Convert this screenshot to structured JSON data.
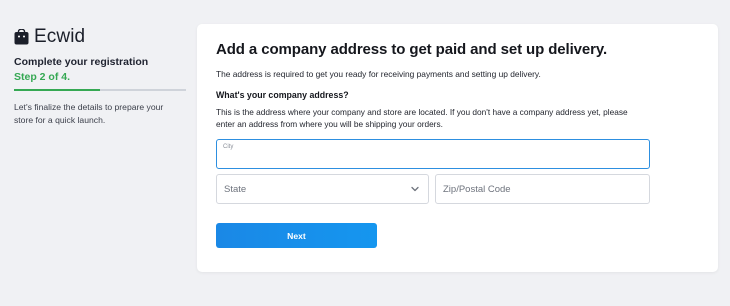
{
  "brand": {
    "name": "Ecwid",
    "icon": "shopping-bag-icon"
  },
  "sidebar": {
    "title": "Complete your registration",
    "step": "Step 2 of 4.",
    "progress": 0.5,
    "description": "Let's finalize the details to prepare your store for a quick launch.",
    "step_color": "#35a853"
  },
  "card": {
    "title": "Add a company address to get paid and set up delivery.",
    "subtitle": "The address is required to get you ready for receiving payments and setting up delivery.",
    "question": "What's your company address?",
    "question_desc": "This is the address where your company and store are located. If you don't have a company address yet, please enter an address from where you will be shipping your orders."
  },
  "form": {
    "city_label": "City",
    "city_value": "",
    "state_placeholder": "State",
    "zip_placeholder": "Zip/Postal Code",
    "next_label": "Next"
  },
  "colors": {
    "accent": "#1a88e6",
    "focus": "#2d8fe0",
    "background": "#f0f1f4"
  }
}
